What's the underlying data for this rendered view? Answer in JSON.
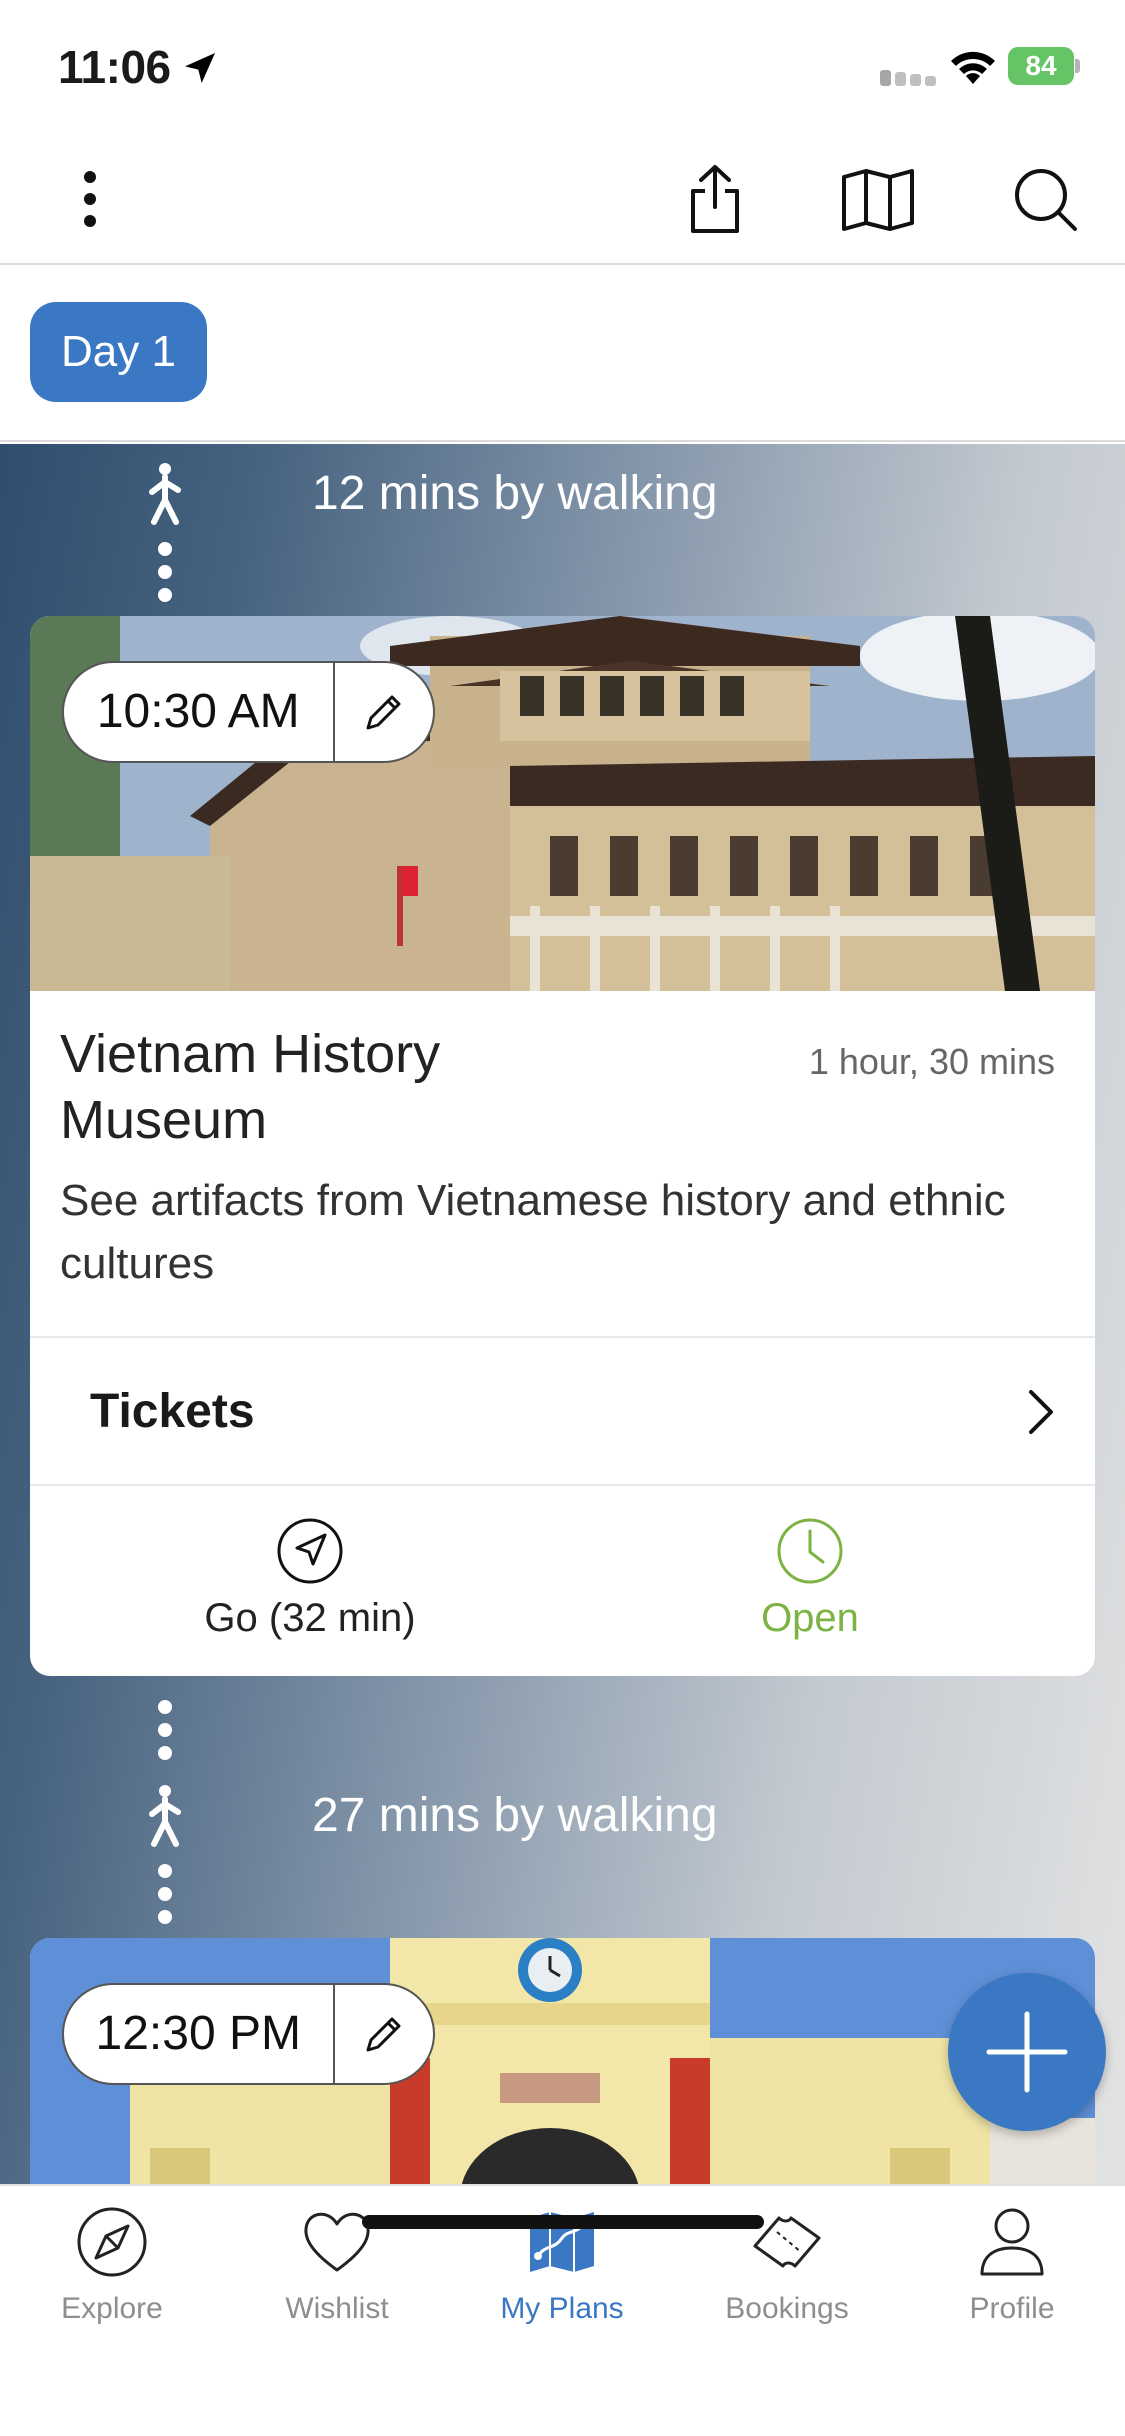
{
  "status_bar": {
    "time": "11:06",
    "battery": "84"
  },
  "colors": {
    "accent": "#3a78c3",
    "open_green": "#7cb342",
    "tab_inactive": "#8e8e8e"
  },
  "toolbar": {
    "icons": [
      "more-vertical-icon",
      "share-icon",
      "map-icon",
      "search-icon"
    ]
  },
  "day_selector": {
    "selected": "Day 1"
  },
  "itinerary": {
    "transit_1": "12 mins by walking",
    "stop_1": {
      "time": "10:30 AM",
      "title": "Vietnam History Museum",
      "duration": "1 hour, 30 mins",
      "description": "See artifacts from Vietnamese history and ethnic cultures",
      "tickets_label": "Tickets",
      "go_label": "Go (32 min)",
      "status_label": "Open"
    },
    "transit_2": "27 mins by walking",
    "stop_2": {
      "time": "12:30 PM"
    }
  },
  "tabbar": {
    "tabs": [
      {
        "label": "Explore",
        "icon": "compass-icon"
      },
      {
        "label": "Wishlist",
        "icon": "heart-icon"
      },
      {
        "label": "My Plans",
        "icon": "folded-map-icon",
        "active": true
      },
      {
        "label": "Bookings",
        "icon": "ticket-icon"
      },
      {
        "label": "Profile",
        "icon": "person-icon"
      }
    ]
  }
}
